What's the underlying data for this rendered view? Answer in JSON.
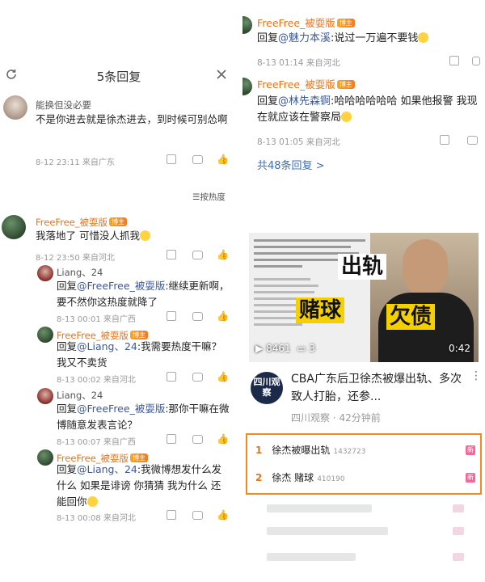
{
  "left": {
    "header": {
      "title": "5条回复"
    },
    "main_comment": {
      "username": "能换但没必要",
      "text": "不是你进去就是徐杰进去，到时候可别怂啊",
      "meta": "8-12 23:11 来自广东"
    },
    "sort_label": "按热度",
    "replies": [
      {
        "username": "FreeFree_被耍版",
        "badge": "博主",
        "text": "我落地了 可惜没人抓我",
        "meta": "8-12 23:50 来自河北",
        "avatar": "green"
      },
      {
        "username": "Liang、24",
        "prefix": "回复",
        "mention": "@FreeFree_被耍版",
        "text": ":继续更新啊，要不然你这热度就降了",
        "meta": "8-13 00:01 来自广西",
        "avatar": "red"
      },
      {
        "username": "FreeFree_被耍版",
        "badge": "博主",
        "prefix": "回复",
        "mention": "@Liang、24",
        "text": ":我需要热度干嘛？我又不卖货",
        "meta": "8-13 00:02 来自河北",
        "avatar": "green"
      },
      {
        "username": "Liang、24",
        "prefix": "回复",
        "mention": "@FreeFree_被耍版",
        "text": ":那你干嘛在微博随意发表言论？",
        "meta": "8-13 00:07 来自广西",
        "avatar": "red"
      },
      {
        "username": "FreeFree_被耍版",
        "badge": "博主",
        "prefix": "回复",
        "mention": "@Liang、24",
        "text": ":我微博想发什么发什么 如果是诽谤 你猜猜 我为什么 还能回你",
        "meta": "8-13 00:08 来自河北",
        "avatar": "green"
      }
    ]
  },
  "right": {
    "replies": [
      {
        "username": "FreeFree_被耍版",
        "badge": "博主",
        "prefix": "回复",
        "mention": "@魅力本溪",
        "text": ":说过一万遍不要钱",
        "meta": "8-13 01:14 来自河北"
      },
      {
        "username": "FreeFree_被耍版",
        "badge": "博主",
        "prefix": "回复",
        "mention": "@林先森锕",
        "text": ":哈哈哈哈哈哈 如果他报警 我现在就应该在警察局",
        "meta": "8-13 01:05 来自河北"
      }
    ],
    "more_replies": "共48条回复 >",
    "video": {
      "tag1": "出轨",
      "tag2": "赌球",
      "tag3": "欠债",
      "play_count": "8461",
      "comment_count": "3",
      "duration": "0:42"
    },
    "news": {
      "source_logo_text": "四川观察",
      "title": "CBA广东后卫徐杰被爆出轨、多次致人打胎，还参...",
      "source": "四川观察",
      "time": "42分钟前"
    },
    "hot_search": [
      {
        "rank": "1",
        "term": "徐杰被曝出轨",
        "count": "1432723",
        "tag": "新"
      },
      {
        "rank": "2",
        "term": "徐杰 赌球",
        "count": "410190",
        "tag": "新"
      }
    ]
  }
}
